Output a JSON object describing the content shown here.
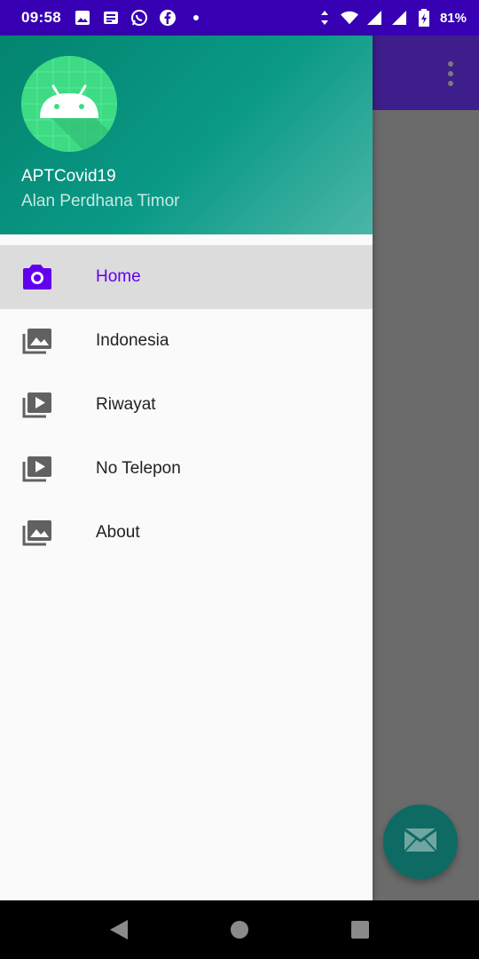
{
  "status_bar": {
    "time": "09:58",
    "battery": "81%",
    "icons": [
      "gallery-icon",
      "news-icon",
      "whatsapp-icon",
      "facebook-icon",
      "dot-icon",
      "data-arrows-icon",
      "wifi-icon",
      "signal-icon",
      "battery-charging-icon"
    ]
  },
  "drawer": {
    "header": {
      "title": "APTCovid19",
      "subtitle": "Alan Perdhana Timor",
      "avatar_icon": "android-icon"
    },
    "items": [
      {
        "label": "Home",
        "icon": "camera-icon",
        "active": true
      },
      {
        "label": "Indonesia",
        "icon": "gallery-icon",
        "active": false
      },
      {
        "label": "Riwayat",
        "icon": "slideshow-icon",
        "active": false
      },
      {
        "label": "No Telepon",
        "icon": "slideshow-icon",
        "active": false
      },
      {
        "label": "About",
        "icon": "gallery-icon",
        "active": false
      }
    ]
  },
  "app": {
    "toolbar_color": "#3e1e8a",
    "fab_icon": "mail-icon"
  },
  "colors": {
    "status_bar": "#3700b3",
    "accent": "#6200ee",
    "header_start": "#03846f",
    "header_end": "#4bb6a8",
    "fab": "#0d6b63"
  },
  "nav_bar": {
    "buttons": [
      "back-icon",
      "home-icon",
      "recents-icon"
    ]
  }
}
